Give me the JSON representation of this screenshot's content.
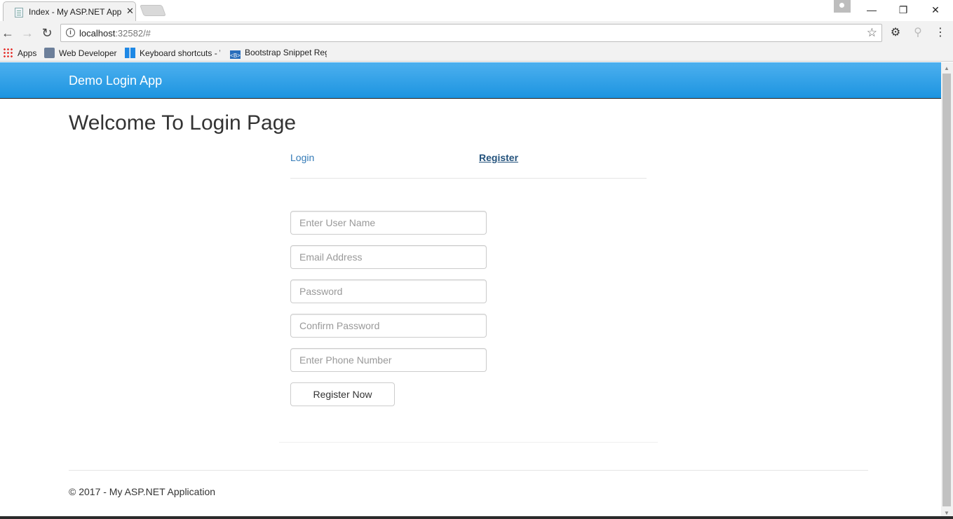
{
  "browser": {
    "tab_title": "Index - My ASP.NET Appl",
    "tab_close": "✕",
    "url_host": "localhost",
    "url_rest": ":32582/#",
    "window": {
      "minimize": "—",
      "maximize": "❐",
      "close": "✕"
    },
    "nav": {
      "back": "←",
      "forward": "→",
      "reload": "↻",
      "info": "i",
      "star": "☆",
      "menu": "⋮",
      "settings": "⚙",
      "ext": "⚲"
    },
    "bookmarks": [
      {
        "label": "Apps"
      },
      {
        "label": "Web Developer"
      },
      {
        "label": "Keyboard shortcuts - W"
      },
      {
        "label": "Bootstrap Snippet Reg"
      }
    ],
    "bs_icon_text": "<B>"
  },
  "page": {
    "brand": "Demo Login App",
    "title": "Welcome To Login Page",
    "tabs": {
      "login": "Login",
      "register": "Register"
    },
    "form": {
      "username_placeholder": "Enter User Name",
      "email_placeholder": "Email Address",
      "password_placeholder": "Password",
      "confirm_placeholder": "Confirm Password",
      "phone_placeholder": "Enter Phone Number",
      "submit_label": "Register Now"
    },
    "footer": "© 2017 - My ASP.NET Application"
  },
  "colors": {
    "navbar_top": "#4db0ef",
    "navbar_bottom": "#1c94e0",
    "link": "#337ab7",
    "link_active": "#23527c"
  }
}
